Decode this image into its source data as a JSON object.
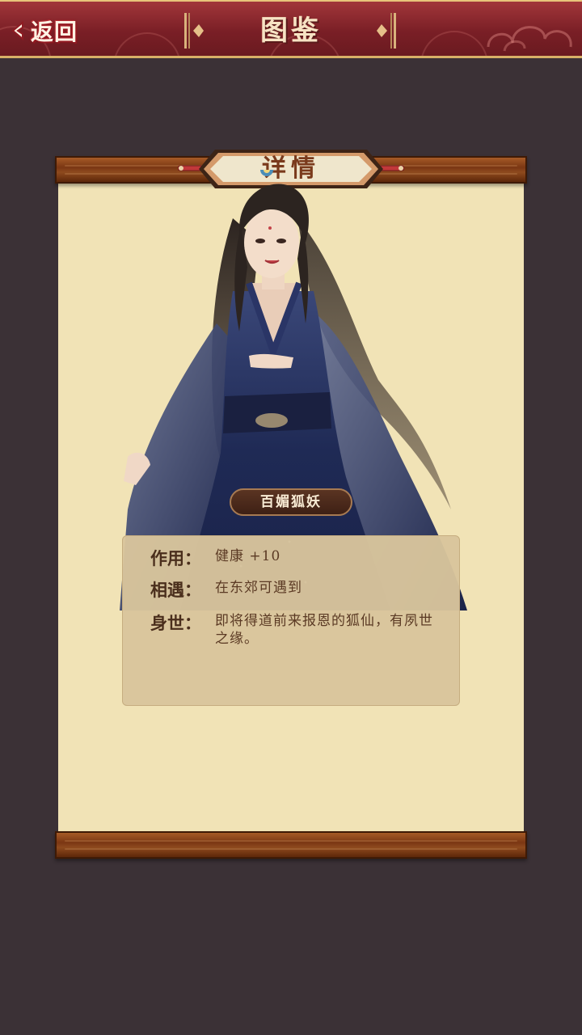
{
  "header": {
    "back_label": "返回",
    "title": "图鉴"
  },
  "scroll": {
    "title": "详情"
  },
  "character": {
    "name": "百媚狐妖"
  },
  "info": {
    "effect_label": "作用：",
    "effect_value": "健康 +10",
    "encounter_label": "相遇：",
    "encounter_value": "在东郊可遇到",
    "background_label": "身世：",
    "background_value": "即将得道前来报恩的狐仙，有夙世之缘。"
  },
  "colors": {
    "page_bg": "#3b3136",
    "header_red": "#7a1f26",
    "paper": "#f1e3b6",
    "wood": "#7a3613",
    "panel": "#d9c59c",
    "name_plate": "#4a2a1b",
    "robe_navy": "#1f2a55"
  },
  "icons": {
    "back": "chevron-left-icon",
    "title_left": "ornament-left-icon",
    "title_right": "ornament-right-icon",
    "cloud": "cloud-pattern-icon"
  }
}
